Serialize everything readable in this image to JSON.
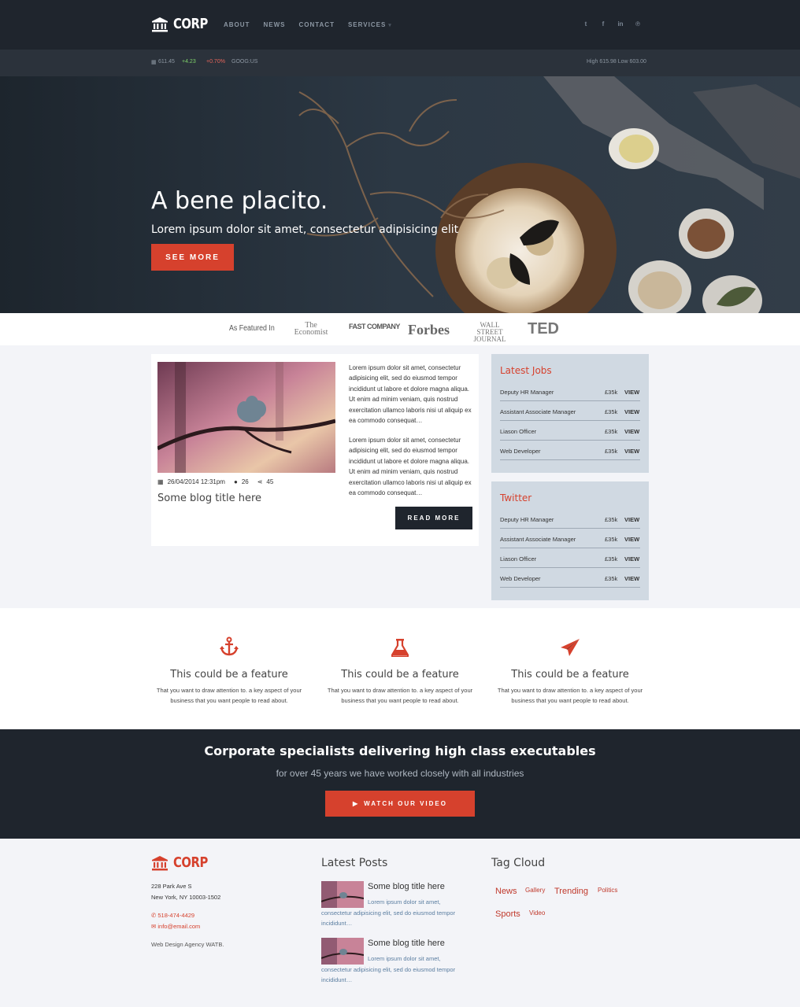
{
  "header": {
    "logo": "CORP",
    "menu": [
      "ABOUT",
      "NEWS",
      "CONTACT",
      "SERVICES"
    ],
    "social_icons": [
      "twitter-icon",
      "facebook-icon",
      "linkedin-icon",
      "pinterest-icon"
    ]
  },
  "ticker": {
    "price": "611.45",
    "change": "+4.23",
    "change_pct": "+0.70%",
    "symbol": "GOOG:US",
    "range": "High 615.98 Low 603.00"
  },
  "hero": {
    "title": "A bene placito.",
    "subtitle": "Lorem ipsum dolor sit amet, consectetur adipisicing elit",
    "button": "SEE MORE"
  },
  "featured": {
    "label": "As Featured In",
    "brands": [
      "The Economist",
      "FAST COMPANY",
      "Forbes",
      "WALL STREET JOURNAL",
      "TED"
    ]
  },
  "blog": {
    "date": "26/04/2014 12:31pm",
    "comments": "26",
    "shares": "45",
    "title": "Some blog title here",
    "para1": "Lorem ipsum dolor sit amet, consectetur adipisicing elit, sed do eiusmod tempor incididunt ut labore et dolore magna aliqua. Ut enim ad minim veniam, quis nostrud exercitation ullamco laboris nisi ut aliquip ex ea commodo consequat…",
    "para2": "Lorem ipsum dolor sit amet, consectetur adipisicing elit, sed do eiusmod tempor incididunt ut labore et dolore magna aliqua. Ut enim ad minim veniam, quis nostrud exercitation ullamco laboris nisi ut aliquip ex ea commodo consequat…",
    "button": "READ MORE"
  },
  "jobs": {
    "title": "Latest Jobs",
    "items": [
      {
        "name": "Deputy HR Manager",
        "salary": "£35k",
        "action": "VIEW"
      },
      {
        "name": "Assistant Associate Manager",
        "salary": "£35k",
        "action": "VIEW"
      },
      {
        "name": "Liason Officer",
        "salary": "£35k",
        "action": "VIEW"
      },
      {
        "name": "Web Developer",
        "salary": "£35k",
        "action": "VIEW"
      }
    ]
  },
  "twitter": {
    "title": "Twitter",
    "items": [
      {
        "name": "Deputy HR Manager",
        "salary": "£35k",
        "action": "VIEW"
      },
      {
        "name": "Assistant Associate Manager",
        "salary": "£35k",
        "action": "VIEW"
      },
      {
        "name": "Liason Officer",
        "salary": "£35k",
        "action": "VIEW"
      },
      {
        "name": "Web Developer",
        "salary": "£35k",
        "action": "VIEW"
      }
    ]
  },
  "features": [
    {
      "icon": "anchor-icon",
      "title": "This could be a feature",
      "desc": "That you want to draw attention to. a key aspect of your business that you want people to read about."
    },
    {
      "icon": "flask-icon",
      "title": "This could be a feature",
      "desc": "That you want to draw attention to. a key aspect of your business that you want people to read about."
    },
    {
      "icon": "paper-plane-icon",
      "title": "This could be a feature",
      "desc": "That you want to draw attention to. a key aspect of your business that you want people to read about."
    }
  ],
  "cta": {
    "title": "Corporate specialists delivering high class executables",
    "subtitle": "for over 45 years we have worked closely with all industries",
    "button": "WATCH OUR VIDEO"
  },
  "footer": {
    "logo": "CORP",
    "address1": "228 Park Ave S",
    "address2": "New York, NY 10003-1502",
    "phone": "518-474-4429",
    "email": "info@email.com",
    "credit": "Web Design Agency WATB.",
    "posts_heading": "Latest Posts",
    "posts": [
      {
        "title": "Some blog title here",
        "excerpt": "Lorem ipsum dolor sit amet, consectetur adipisicing elit, sed do eiusmod tempor incididunt…"
      },
      {
        "title": "Some blog title here",
        "excerpt": "Lorem ipsum dolor sit amet, consectetur adipisicing elit, sed do eiusmod tempor incididunt…"
      }
    ],
    "tags_heading": "Tag Cloud",
    "tags": [
      "News",
      "Gallery",
      "Trending",
      "Politics",
      "Sports",
      "Video"
    ]
  },
  "colors": {
    "accent": "#d6412d",
    "dark": "#1f252d",
    "panel": "#d0d9e2"
  }
}
